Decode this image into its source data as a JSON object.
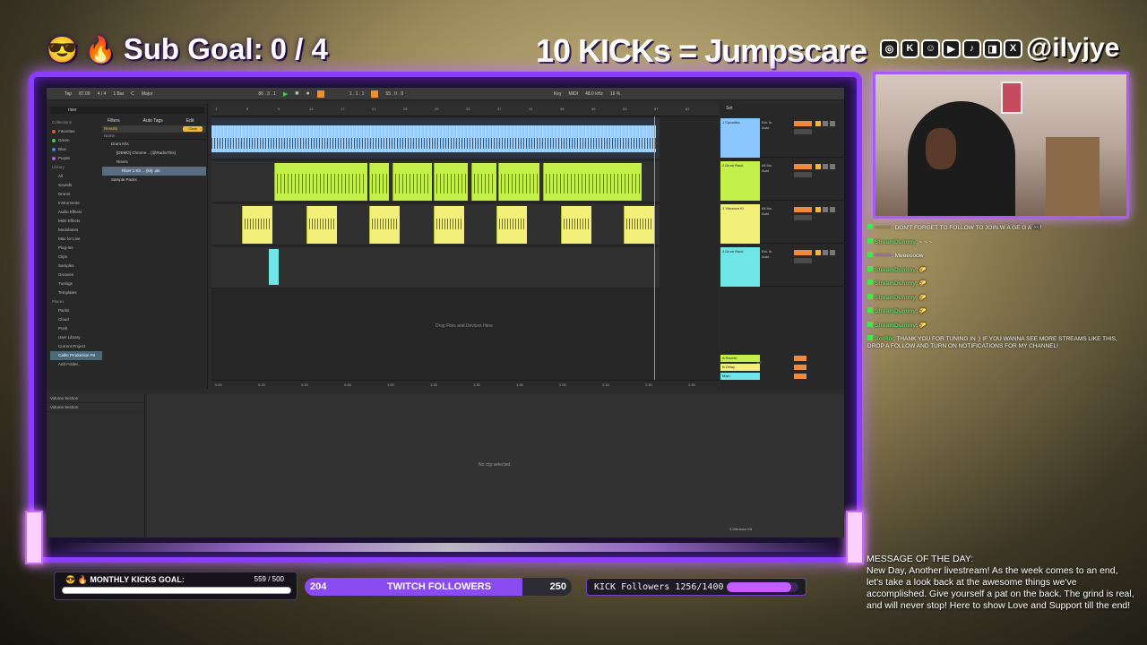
{
  "overlay": {
    "sub_goal": {
      "emoji_1": "😎",
      "emoji_2": "🔥",
      "text": "Sub Goal:",
      "value": "0 / 4"
    },
    "kick_banner": "10 KICKs = Jumpscare",
    "socials": {
      "icons": [
        "instagram-icon",
        "kick-icon",
        "snapchat-icon",
        "youtube-icon",
        "tiktok-icon",
        "twitch-icon",
        "x-icon"
      ],
      "handle": "@ilyjye"
    }
  },
  "daw": {
    "topbar": [
      "Tap",
      "87.00",
      "4 / 4",
      "1 Bar",
      "C",
      "Major",
      "86 . 3 . 1",
      "1 . 1 . 1",
      "55 . 0 . 0",
      "Key",
      "MIDI",
      "48.0 kHz",
      "16 %"
    ],
    "browser": {
      "search": "riser",
      "collections_header": "Collections",
      "collections": [
        {
          "label": "Favorites",
          "color": "#e8553a"
        },
        {
          "label": "Green",
          "color": "#47c84a"
        },
        {
          "label": "Blue",
          "color": "#3a8ae8"
        },
        {
          "label": "Purple",
          "color": "#b25ce0"
        }
      ],
      "library_header": "Library",
      "library": [
        "All",
        "Sounds",
        "Drums",
        "Instruments",
        "Audio Effects",
        "MIDI Effects",
        "Modulators",
        "Max for Live",
        "Plug-Ins",
        "Clips",
        "Samples",
        "Grooves",
        "Tunings",
        "Templates"
      ],
      "places_header": "Places",
      "places": [
        "Packs",
        "Cloud",
        "Push",
        "User Library",
        "Current Project",
        "Cable Production Pa",
        "Add Folder..."
      ],
      "filters_label": "Filters",
      "auto_tags": "Auto Tags",
      "edit": "Edit",
      "results": "Results",
      "clear": "Clear",
      "name_header": "Name",
      "results_items": [
        "Drum Kits",
        "[DEMO] Chrome... (@RadioThis)",
        "Risers",
        "Riser 1 Kit ... (kit) .alc",
        "Sample Packs"
      ],
      "volume_section": [
        "Volume Section",
        "Volume Section"
      ]
    },
    "arrangement": {
      "ruler": [
        "1",
        "5",
        "9",
        "13",
        "17",
        "21",
        "25",
        "29",
        "33",
        "37",
        "41",
        "45",
        "49",
        "53",
        "57",
        "61"
      ],
      "clip_label": "Cymatics - Amber Ruby - 82 BPM C# Min",
      "drop_text": "Drop Files and Devices Here",
      "time_ruler": [
        "0:00",
        "0:15",
        "0:30",
        "0:45",
        "1:00",
        "1:15",
        "1:30",
        "1:45",
        "2:00",
        "2:15",
        "2:30",
        "2:45"
      ]
    },
    "mixer": {
      "tracks": [
        {
          "name": "1 Cymatics",
          "color": "#8cc6ff",
          "input": "Ext. In",
          "mode": "Auto"
        },
        {
          "name": "2 Drum Rack",
          "color": "#c4f04a",
          "input": "All Ins",
          "mode": "Auto"
        },
        {
          "name": "3 Vibrance Ki",
          "color": "#f3f07a",
          "input": "All Ins",
          "mode": "Auto"
        },
        {
          "name": "4 Drum Rack",
          "color": "#6fe5e8",
          "input": "Ext. In",
          "mode": "Auto"
        }
      ],
      "returns": [
        {
          "name": "A Reverb",
          "color": "#c4f04a"
        },
        {
          "name": "B Delay",
          "color": "#f3f07a"
        },
        {
          "name": "Main",
          "color": "#6fe5e8"
        }
      ],
      "set_label": "Set",
      "sends_label": "1/2"
    },
    "detail": {
      "no_clip": "No clip selected."
    },
    "status": "3-Vibrance Kit"
  },
  "chat": [
    {
      "user": "~~~~~",
      "user_color": "red",
      "text": ": DON'T FORGET TO FOLLOW TO JOIN W A GE G A 🎮!"
    },
    {
      "user": "StreamDummy",
      "user_color": "green",
      "text": ": ~ ~ ~"
    },
    {
      "user": "~~~~~",
      "user_color": "purple",
      "text": ": Meeeooow"
    },
    {
      "user": "StreamDummy",
      "user_color": "green",
      "text": ": 🌮"
    },
    {
      "user": "StreamDummy",
      "user_color": "green",
      "text": ": 🌮"
    },
    {
      "user": "StreamDummy",
      "user_color": "green",
      "text": ": 🌮"
    },
    {
      "user": "StreamDummy",
      "user_color": "green",
      "text": ": 🌮"
    },
    {
      "user": "StreamDummy",
      "user_color": "green",
      "text": ": 🌮"
    },
    {
      "user": "BotRix",
      "user_color": "green",
      "text": ": THANK YOU FOR TUNING IN :) IF YOU WANNA SEE MORE STREAMS LIKE THIS, DROP A FOLLOW AND TURN ON NOTIFICATIONS FOR MY CHANNEL!"
    }
  ],
  "motd": {
    "title": "MESSAGE OF THE DAY:",
    "text": "New Day, Another livestream! As the week comes to an end, let's take a look back at the awesome things we've accomplished. Give yourself a pat on the back. The grind is real, and will never stop! Here to show Love and Support till the end!"
  },
  "bars": {
    "kicks_goal": {
      "label": "😎 🔥 MONTHLY KICKS GOAL:",
      "count": "559 / 500",
      "progress": 1.0
    },
    "twitch": {
      "current": "204",
      "label": "TWITCH FOLLOWERS",
      "goal": "250",
      "progress": 0.816
    },
    "kick": {
      "label": "KICK Followers 1256/1400",
      "progress": 0.897
    }
  },
  "colors": {
    "frame": "#8b3cff",
    "accent": "#b569ff",
    "play": "#3ad14f",
    "clip_green": "#c4f04a",
    "clip_yellow": "#f3f07a",
    "clip_blue": "#8cc6ff",
    "clip_cyan": "#6fe5e8"
  }
}
